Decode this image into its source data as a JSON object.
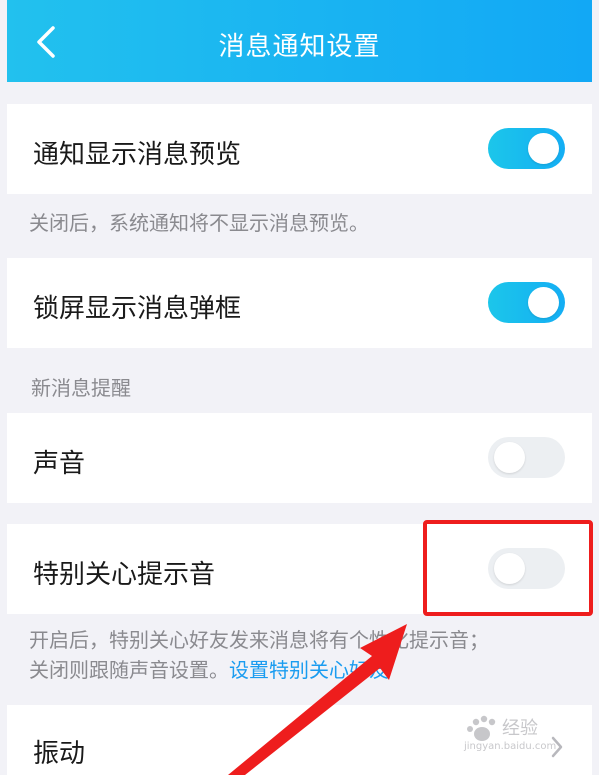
{
  "header": {
    "title": "消息通知设置"
  },
  "rows": {
    "preview": {
      "label": "通知显示消息预览",
      "toggle": "on"
    },
    "preview_hint": "关闭后，系统通知将不显示消息预览。",
    "lockscreen": {
      "label": "锁屏显示消息弹框",
      "toggle": "on"
    },
    "section_title": "新消息提醒",
    "sound": {
      "label": "声音",
      "toggle": "off"
    },
    "special": {
      "label": "特别关心提示音",
      "toggle": "off"
    },
    "special_hint_line1": "开启后，特别关心好友发来消息将有个性化提示音；",
    "special_hint_line2": "关闭则跟随声音设置。",
    "special_hint_link": "设置特别关心好友",
    "vibrate": {
      "label": "振动"
    }
  },
  "watermark": {
    "text": "经验",
    "domain": "jingyan.baidu.com"
  },
  "colors": {
    "accent": "#12a8f5",
    "highlight": "#ee1d1d",
    "link": "#1a9cf0"
  }
}
